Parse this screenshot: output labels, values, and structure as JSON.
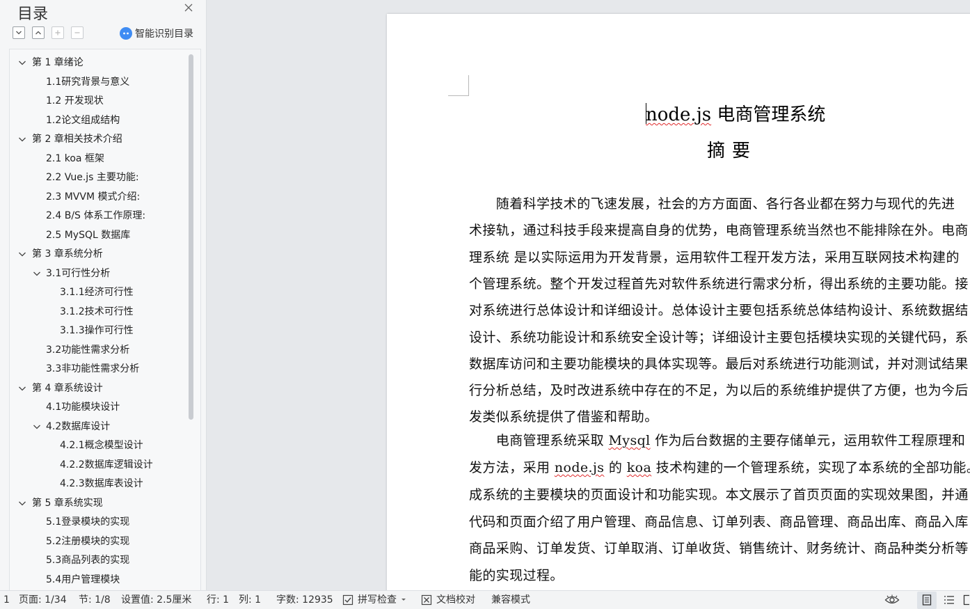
{
  "sidebar": {
    "title": "目录",
    "smart_label": "智能识别目录",
    "toc": [
      {
        "label": "第 1 章绪论",
        "level": 0,
        "expandable": true
      },
      {
        "label": "1.1研究背景与意义",
        "level": 1,
        "expandable": false
      },
      {
        "label": "1.2 开发现状",
        "level": 1,
        "expandable": false
      },
      {
        "label": "1.2论文组成结构",
        "level": 1,
        "expandable": false
      },
      {
        "label": "第 2 章相关技术介绍",
        "level": 0,
        "expandable": true
      },
      {
        "label": "2.1  koa 框架",
        "level": 1,
        "expandable": false
      },
      {
        "label": "2.2 Vue.js  主要功能:",
        "level": 1,
        "expandable": false
      },
      {
        "label": "2.3    MVVM 模式介绍:",
        "level": 1,
        "expandable": false
      },
      {
        "label": "2.4    B/S 体系工作原理:",
        "level": 1,
        "expandable": false
      },
      {
        "label": "2.5 MySQL 数据库",
        "level": 1,
        "expandable": false
      },
      {
        "label": "第 3 章系统分析",
        "level": 0,
        "expandable": true
      },
      {
        "label": "3.1可行性分析",
        "level": 1,
        "expandable": true
      },
      {
        "label": "3.1.1经济可行性",
        "level": 2,
        "expandable": false
      },
      {
        "label": "3.1.2技术可行性",
        "level": 2,
        "expandable": false
      },
      {
        "label": "3.1.3操作可行性",
        "level": 2,
        "expandable": false
      },
      {
        "label": "3.2功能性需求分析",
        "level": 1,
        "expandable": false
      },
      {
        "label": "3.3非功能性需求分析",
        "level": 1,
        "expandable": false
      },
      {
        "label": "第 4 章系统设计",
        "level": 0,
        "expandable": true
      },
      {
        "label": "4.1功能模块设计",
        "level": 1,
        "expandable": false
      },
      {
        "label": "4.2数据库设计",
        "level": 1,
        "expandable": true
      },
      {
        "label": "4.2.1概念模型设计",
        "level": 2,
        "expandable": false
      },
      {
        "label": "4.2.2数据库逻辑设计",
        "level": 2,
        "expandable": false
      },
      {
        "label": "4.2.3数据库表设计",
        "level": 2,
        "expandable": false
      },
      {
        "label": "第 5 章系统实现",
        "level": 0,
        "expandable": true
      },
      {
        "label": "5.1登录模块的实现",
        "level": 1,
        "expandable": false
      },
      {
        "label": "5.2注册模块的实现",
        "level": 1,
        "expandable": false
      },
      {
        "label": "5.3商品列表的实现",
        "level": 1,
        "expandable": false
      },
      {
        "label": "5.4用户管理模块",
        "level": 1,
        "expandable": false
      }
    ]
  },
  "document": {
    "title_pre": "node.js",
    "title_post": " 电商管理系统",
    "abstract_heading": "摘要",
    "lines": [
      [
        {
          "t": "　　随着科学技术的飞速发展，社会的方方面面、各行各业都在努力与现代的先进"
        }
      ],
      [
        {
          "t": "术接轨，通过科技手段来提高自身的优势，电商管理系统当然也不能排除在外。电商"
        }
      ],
      [
        {
          "t": "理系统  是以实际运用为开发背景，运用软件工程开发方法，采用互联网技术构建的"
        }
      ],
      [
        {
          "t": "个管理系统。整个开发过程首先对软件系统进行需求分析，得出系统的主要功能。接"
        }
      ],
      [
        {
          "t": "对系统进行总体设计和详细设计。总体设计主要包括系统总体结构设计、系统数据结"
        }
      ],
      [
        {
          "t": "设计、系统功能设计和系统安全设计等；详细设计主要包括模块实现的关键代码，系"
        }
      ],
      [
        {
          "t": "数据库访问和主要功能模块的具体实现等。最后对系统进行功能测试，并对测试结果"
        }
      ],
      [
        {
          "t": "行分析总结，及时改进系统中存在的不足，为以后的系统维护提供了方便，也为今后"
        }
      ],
      [
        {
          "t": "发类似系统提供了借鉴和帮助。"
        }
      ],
      [
        {
          "t": "　　电商管理系统采取 "
        },
        {
          "t": "Mysql",
          "spell": true
        },
        {
          "t": " 作为后台数据的主要存储单元，运用软件工程原理和"
        }
      ],
      [
        {
          "t": "发方法，采用 "
        },
        {
          "t": "node.js",
          "spell": true
        },
        {
          "t": " 的 "
        },
        {
          "t": "koa",
          "spell": true
        },
        {
          "t": " 技术构建的一个管理系统，实现了本系统的全部功能。"
        }
      ],
      [
        {
          "t": "成系统的主要模块的页面设计和功能实现。本文展示了首页页面的实现效果图，并通"
        }
      ],
      [
        {
          "t": "代码和页面介绍了用户管理、商品信息、订单列表、商品管理、商品出库、商品入库"
        }
      ],
      [
        {
          "t": "商品采购、订单发货、订单取消、订单收货、销售统计、财务统计、商品种类分析等"
        }
      ],
      [
        {
          "t": "能的实现过程。"
        }
      ]
    ]
  },
  "statusbar": {
    "section_num": "1",
    "page": "页面: 1/34",
    "section": "节: 1/8",
    "setting": "设置值: 2.5厘米",
    "row": "行: 1",
    "col": "列: 1",
    "words": "字数: 12935",
    "spellcheck": "拼写检查",
    "proofread": "文档校对",
    "compat": "兼容模式"
  }
}
